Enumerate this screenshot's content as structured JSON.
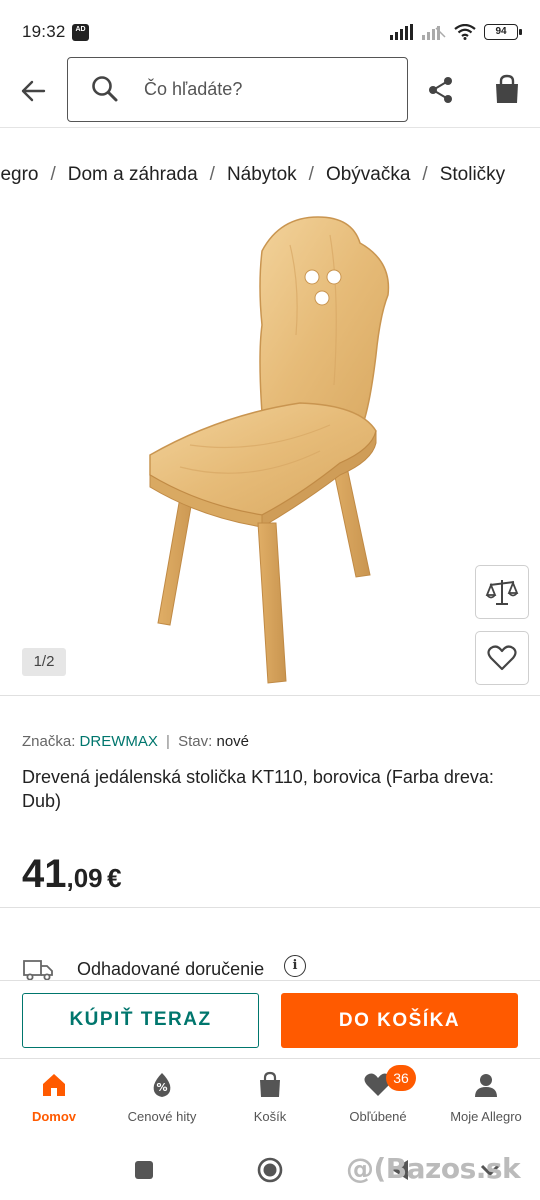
{
  "status_bar": {
    "time": "19:32",
    "ad_icon_text": "AD",
    "battery": "94"
  },
  "header": {
    "search_placeholder": "Čo hľadáte?"
  },
  "breadcrumb": [
    "llegro",
    "Dom a záhrada",
    "Nábytok",
    "Obývačka",
    "Stoličky"
  ],
  "gallery": {
    "counter": "1/2"
  },
  "product": {
    "brand_label": "Značka:",
    "brand_value": "DREWMAX",
    "separator": "|",
    "state_label": "Stav:",
    "state_value": "nové",
    "title": "Drevená jedálenská stolička KT110, borovica (Farba dreva: Dub)",
    "price_int": "41",
    "price_dec": ",09",
    "price_currency": "€"
  },
  "delivery": {
    "label": "Odhadované doručenie",
    "info_icon": "i"
  },
  "actions": {
    "buy_now": "KÚPIŤ TERAZ",
    "add_to_cart": "DO KOŠÍKA"
  },
  "bottom_nav": [
    {
      "label": "Domov",
      "icon": "home-icon",
      "active": true
    },
    {
      "label": "Cenové hity",
      "icon": "discount-icon",
      "active": false
    },
    {
      "label": "Košík",
      "icon": "cart-icon",
      "active": false
    },
    {
      "label": "Obľúbené",
      "icon": "heart-icon",
      "active": false,
      "badge": "36"
    },
    {
      "label": "Moje Allegro",
      "icon": "user-icon",
      "active": false
    }
  ],
  "watermark": "@(Bazos.sk",
  "colors": {
    "accent_orange": "#ff5a00",
    "accent_teal": "#00766d",
    "text_dark": "#222222"
  }
}
